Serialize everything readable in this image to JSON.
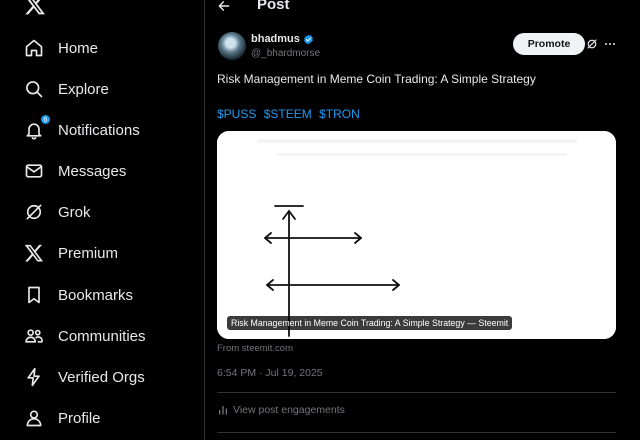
{
  "sidebar": {
    "logo": "x-logo-icon",
    "items": [
      {
        "label": "Home",
        "icon": "home-icon"
      },
      {
        "label": "Explore",
        "icon": "search-icon"
      },
      {
        "label": "Notifications",
        "icon": "bell-icon",
        "badge": "6"
      },
      {
        "label": "Messages",
        "icon": "envelope-icon"
      },
      {
        "label": "Grok",
        "icon": "grok-icon"
      },
      {
        "label": "Premium",
        "icon": "x-logo-icon"
      },
      {
        "label": "Bookmarks",
        "icon": "bookmark-icon"
      },
      {
        "label": "Communities",
        "icon": "people-icon"
      },
      {
        "label": "Verified Orgs",
        "icon": "lightning-icon"
      },
      {
        "label": "Profile",
        "icon": "person-icon"
      }
    ]
  },
  "header": {
    "title": "Post"
  },
  "post": {
    "author": {
      "name": "bhadmus",
      "handle": "@_bhardmorse",
      "verified": true
    },
    "promote_label": "Promote",
    "text": "Risk Management in Meme Coin Trading: A Simple Strategy",
    "cashtags": [
      "$PUSS",
      "$STEEM",
      "$TRON"
    ],
    "card": {
      "caption": "Risk Management in Meme Coin Trading: A Simple Strategy — Steemit",
      "source": "From steemit.com"
    },
    "timestamp": "6:54 PM · Jul 19, 2025",
    "engagements_label": "View post engagements"
  },
  "colors": {
    "accent": "#1d9bf0",
    "background": "#000000",
    "text": "#e7e9ea",
    "muted": "#71767b"
  }
}
